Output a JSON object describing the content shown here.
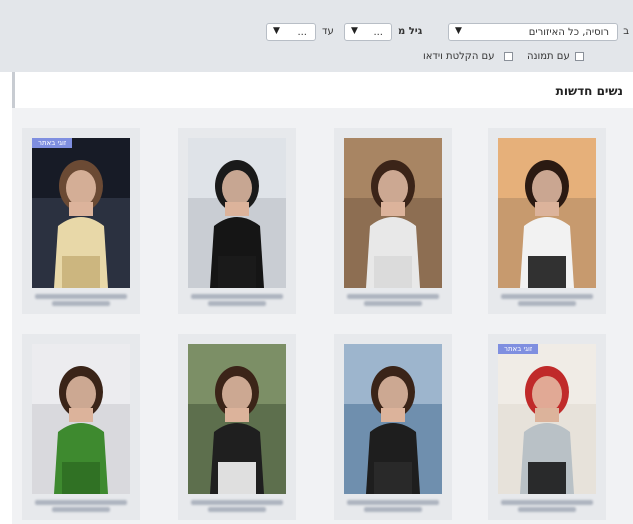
{
  "search": {
    "location_prefix": "ב",
    "location_value": "רוסיה, כל האיזורים",
    "age_label": "גיל מ",
    "age_from_value": "...",
    "age_to_label": "עד",
    "age_to_value": "...",
    "with_photo_label": "עם תמונה",
    "with_video_label": "עם הקלטת וידאו"
  },
  "section": {
    "title": "נשים חדשות"
  },
  "cards": [
    {
      "badge": "",
      "photo": {
        "bg": "#c79a6e",
        "sky": "#e6b07a",
        "hair": "#2b1a12",
        "top": "#f2f2f2",
        "bottom": "#1c1c1c"
      }
    },
    {
      "badge": "",
      "photo": {
        "bg": "#8d6e52",
        "sky": "#a88563",
        "hair": "#3b2418",
        "top": "#e8e8e8",
        "bottom": "#d9d9d9"
      }
    },
    {
      "badge": "",
      "photo": {
        "bg": "#c9cdd3",
        "sky": "#dfe3e8",
        "hair": "#1a1a1a",
        "top": "#151515",
        "bottom": "#1b1b1b"
      }
    },
    {
      "badge": "זוגי באתר",
      "photo": {
        "bg": "#2b3140",
        "sky": "#171b26",
        "hair": "#6b4a34",
        "top": "#e8d8a8",
        "bottom": "#c9b27a"
      }
    },
    {
      "badge": "זוגי באתר",
      "photo": {
        "bg": "#e7e2da",
        "sky": "#f0ece6",
        "hair": "#c02a2a",
        "top": "#b9c1c6",
        "bottom": "#1a1a1a"
      }
    },
    {
      "badge": "",
      "photo": {
        "bg": "#6f8fae",
        "sky": "#9db5cd",
        "hair": "#3a2418",
        "top": "#1e1e1e",
        "bottom": "#2a2a2a"
      }
    },
    {
      "badge": "",
      "photo": {
        "bg": "#5d6f4d",
        "sky": "#7c8f66",
        "hair": "#3b2418",
        "top": "#1f1f1f",
        "bottom": "#f4f4f4"
      }
    },
    {
      "badge": "",
      "photo": {
        "bg": "#d9d9dd",
        "sky": "#ececef",
        "hair": "#3a2418",
        "top": "#3e8a2f",
        "bottom": "#2f6e24"
      }
    }
  ]
}
